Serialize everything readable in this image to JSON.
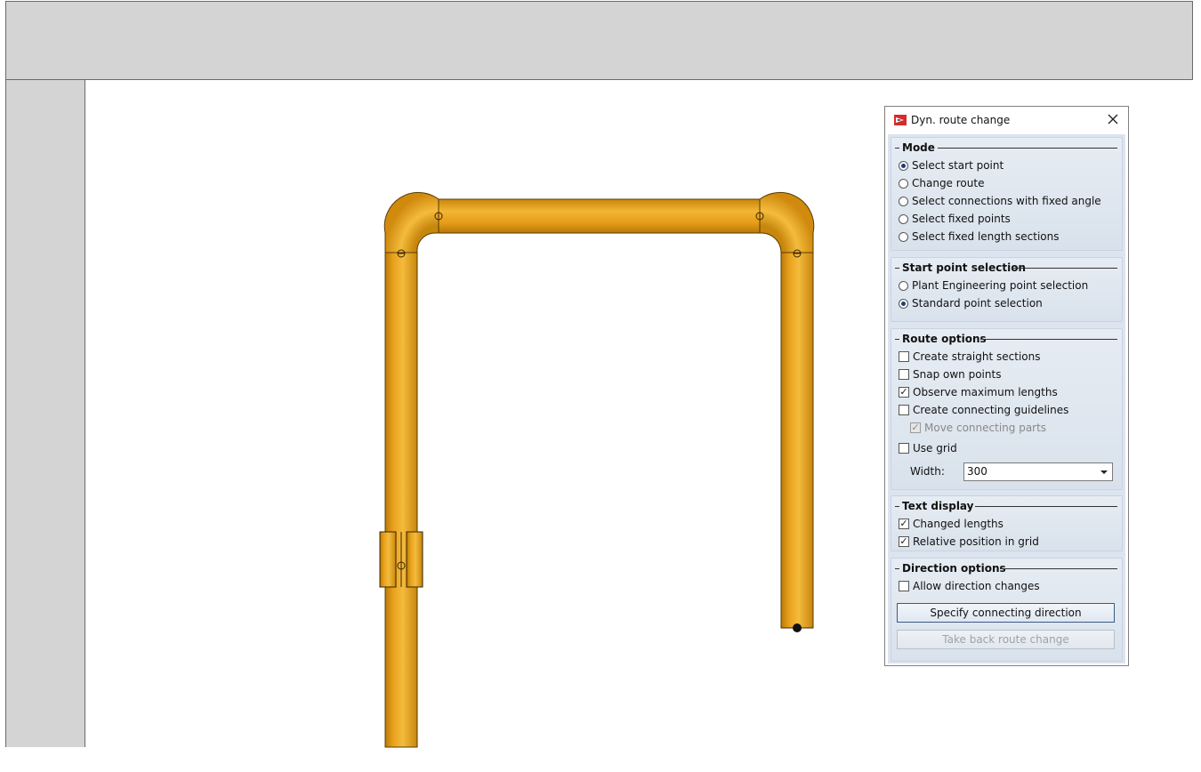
{
  "dialog": {
    "title": "Dyn. route change",
    "close_icon": "close-icon",
    "app_icon": "route-change-app-icon",
    "groups": {
      "mode": {
        "title": "Mode",
        "options": [
          {
            "label": "Select start point",
            "selected": true
          },
          {
            "label": "Change route",
            "selected": false
          },
          {
            "label": "Select connections with fixed angle",
            "selected": false
          },
          {
            "label": "Select fixed points",
            "selected": false
          },
          {
            "label": "Select fixed length sections",
            "selected": false
          }
        ]
      },
      "start_point": {
        "title": "Start point selection",
        "options": [
          {
            "label": "Plant Engineering point selection",
            "selected": false
          },
          {
            "label": "Standard point selection",
            "selected": true
          }
        ]
      },
      "route_options": {
        "title": "Route options",
        "checks": [
          {
            "label": "Create straight sections",
            "checked": false,
            "enabled": true
          },
          {
            "label": "Snap own points",
            "checked": false,
            "enabled": true
          },
          {
            "label": "Observe maximum lengths",
            "checked": true,
            "enabled": true
          },
          {
            "label": "Create connecting guidelines",
            "checked": false,
            "enabled": true
          },
          {
            "label": "Move connecting parts",
            "checked": true,
            "enabled": false
          },
          {
            "label": "Use grid",
            "checked": false,
            "enabled": true
          }
        ],
        "width_label": "Width:",
        "width_value": "300"
      },
      "text_display": {
        "title": "Text display",
        "checks": [
          {
            "label": "Changed lengths",
            "checked": true
          },
          {
            "label": "Relative position in grid",
            "checked": true
          }
        ]
      },
      "direction": {
        "title": "Direction options",
        "checks": [
          {
            "label": "Allow direction changes",
            "checked": false
          }
        ],
        "specify_button": "Specify connecting direction",
        "takeback_button": "Take back route change"
      }
    }
  },
  "colors": {
    "pipe": "#e8a01c",
    "pipe_dark": "#b57808",
    "pipe_light": "#f6c24d",
    "chrome": "#d4d4d4"
  }
}
